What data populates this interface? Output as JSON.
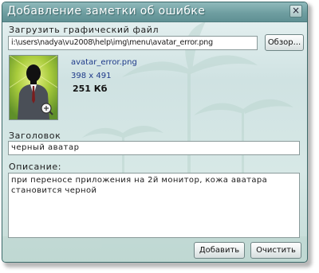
{
  "window": {
    "title": "Добавление заметки об ошибке"
  },
  "upload": {
    "label": "Загрузить графический файл",
    "path_value": "i:\\users\\nadya\\vu2008\\help\\img\\menu\\avatar_error.png",
    "browse_label": "Обзор..."
  },
  "image_info": {
    "filename": "avatar_error.png",
    "dimensions": "398 x 491",
    "size": "251 Кб"
  },
  "heading": {
    "label": "Заголовок",
    "value": "черный аватар"
  },
  "description": {
    "label": "Описание:",
    "value": "при переносе приложения на 2й монитор, кожа аватара становится черной"
  },
  "buttons": {
    "add": "Добавить",
    "clear": "Очистить"
  },
  "icons": {
    "close": "close-icon",
    "zoom": "magnifier-plus-icon"
  },
  "colors": {
    "titlebar": "#6f9ea1",
    "link_text": "#1e3a8a",
    "avatar_bg": "#9fc53a"
  }
}
